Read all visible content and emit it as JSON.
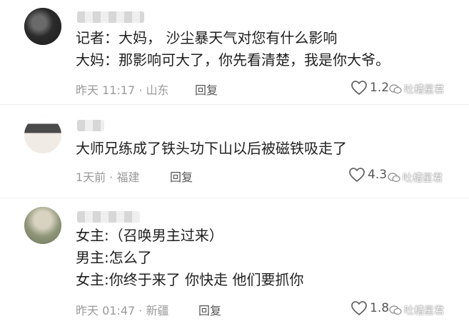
{
  "comments": [
    {
      "lines": [
        "记者：大妈， 沙尘暴天气对您有什么影响",
        "大妈：那影响可大了，你先看清楚，我是你大爷。"
      ],
      "time_location": "昨天 11:17 · 山东",
      "reply_label": "回复",
      "like_count": "1.2"
    },
    {
      "lines": [
        "大师兄练成了铁头功下山以后被磁铁吸走了"
      ],
      "time_location": "1天前 · 福建",
      "reply_label": "回复",
      "like_count": "4.3"
    },
    {
      "lines": [
        "女主:（召唤男主过来）",
        "男主:怎么了",
        "女主:你终于来了 你快走 他们要抓你"
      ],
      "time_location": "昨天 01:47 · 新疆",
      "reply_label": "回复",
      "like_count": "1.8"
    }
  ],
  "watermark": "吐槽星君",
  "icons": {
    "like": "heart-icon",
    "watermark": "wechat-icon"
  },
  "colors": {
    "meta_text": "#9a9a9a",
    "body_text": "#1f1f1f",
    "divider": "#eeeeee"
  }
}
